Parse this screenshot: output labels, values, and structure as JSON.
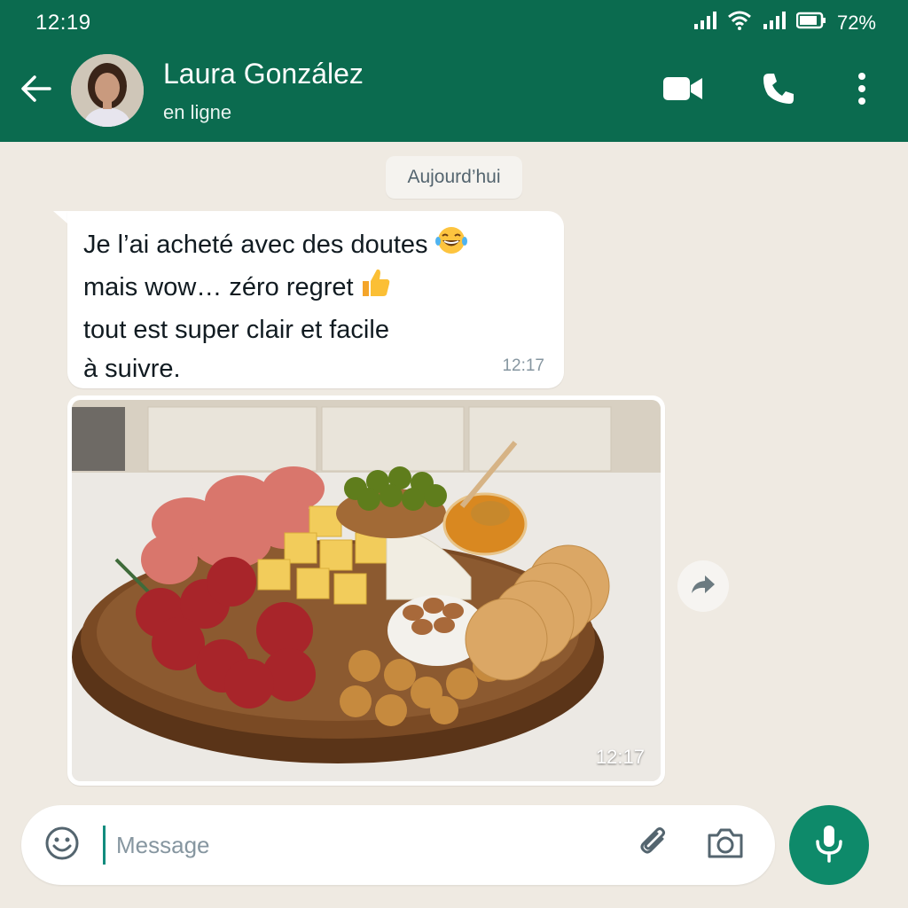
{
  "status_bar": {
    "time": "12:19",
    "battery": "72%",
    "icons": [
      "signal-icon",
      "wifi-icon",
      "signal-icon",
      "battery-icon"
    ]
  },
  "header": {
    "contact_name": "Laura González",
    "contact_status": "en ligne",
    "icons": [
      "back-arrow-icon",
      "video-call-icon",
      "phone-icon",
      "more-options-icon"
    ]
  },
  "chat": {
    "date_chip": "Aujourd’hui",
    "messages": [
      {
        "type": "text",
        "lines": [
          "Je l’ai acheté avec des doutes",
          "mais wow… zéro regret",
          "tout est super clair et facile",
          "à suivre."
        ],
        "emojis": [
          "😂",
          "👍"
        ],
        "time": "12:17"
      },
      {
        "type": "image",
        "image_desc": "charcuterie-board-photo",
        "time": "12:17"
      }
    ]
  },
  "input": {
    "placeholder": "Message",
    "icons": [
      "emoji-icon",
      "attach-icon",
      "camera-icon",
      "mic-icon"
    ]
  },
  "colors": {
    "header": "#0b6b4f",
    "accent": "#0e8a6a",
    "chat_bg": "#efeae2",
    "bubble": "#ffffff",
    "meta_text": "#8696a0"
  }
}
